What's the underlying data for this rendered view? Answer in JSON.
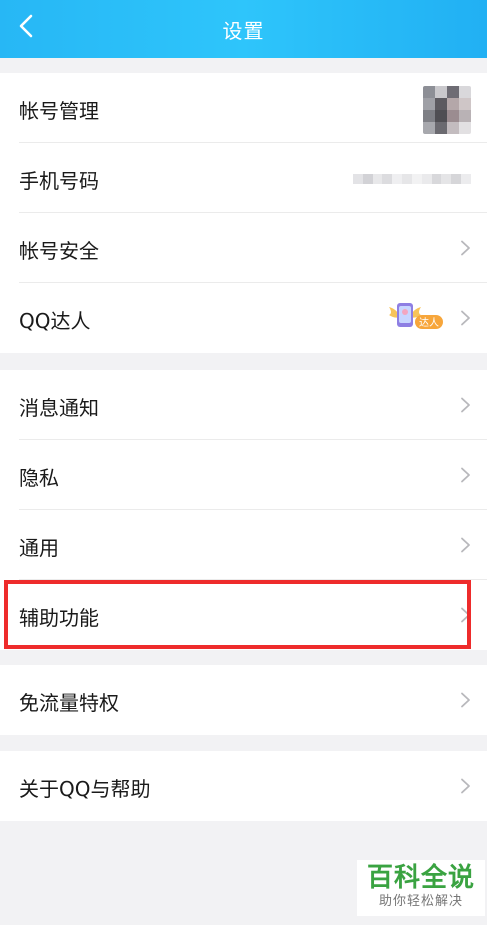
{
  "header": {
    "title": "设置",
    "back_icon": "chevron-left-icon"
  },
  "groups": [
    {
      "items": [
        {
          "label": "帐号管理",
          "trailing": "avatar"
        },
        {
          "label": "手机号码",
          "trailing": "blurred-phone"
        },
        {
          "label": "帐号安全",
          "trailing": "chevron"
        },
        {
          "label": "QQ达人",
          "trailing": "badge",
          "badge_text": "达人"
        }
      ]
    },
    {
      "items": [
        {
          "label": "消息通知",
          "trailing": "chevron"
        },
        {
          "label": "隐私",
          "trailing": "chevron"
        },
        {
          "label": "通用",
          "trailing": "chevron"
        },
        {
          "label": "辅助功能",
          "trailing": "chevron",
          "highlighted": true
        }
      ]
    },
    {
      "items": [
        {
          "label": "免流量特权",
          "trailing": "chevron"
        }
      ]
    },
    {
      "items": [
        {
          "label": "关于QQ与帮助",
          "trailing": "chevron"
        }
      ]
    }
  ],
  "watermark": {
    "title": "百科全说",
    "subtitle": "助你轻松解决"
  },
  "colors": {
    "header": "#2ec5fb",
    "highlight_border": "#ee2b2b",
    "watermark_green": "#3aa341",
    "background": "#f2f2f4"
  }
}
